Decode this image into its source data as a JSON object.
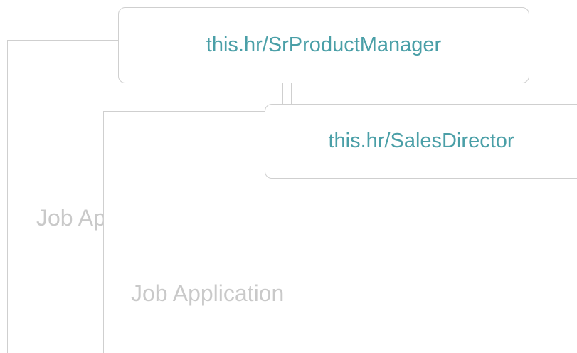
{
  "documents": [
    {
      "label": "Job Application"
    },
    {
      "label": "Job Application"
    }
  ],
  "links": [
    {
      "url": "this.hr/SrProductManager"
    },
    {
      "url": "this.hr/SalesDirector"
    }
  ],
  "colors": {
    "link_text": "#4a9fa7",
    "document_label": "#c9c9c9",
    "border": "#cfcfcf"
  }
}
